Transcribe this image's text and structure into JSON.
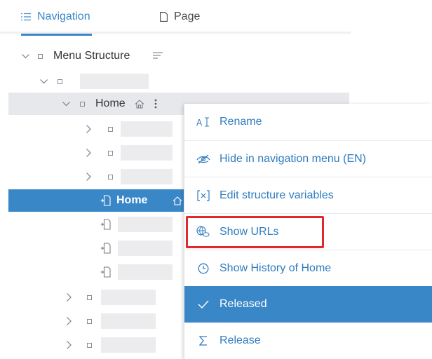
{
  "tabs": [
    {
      "label": "Navigation",
      "icon": "list-icon",
      "active": true
    },
    {
      "label": "Page",
      "icon": "page-icon",
      "active": false
    }
  ],
  "tree": {
    "root_label": "Menu Structure",
    "home_label": "Home",
    "selected_home_label": "Home"
  },
  "context_menu": {
    "items": [
      {
        "label": "Rename",
        "icon": "rename-icon"
      },
      {
        "label": "Hide in navigation menu (EN)",
        "icon": "eye-off-icon"
      },
      {
        "label": "Edit structure variables",
        "icon": "variable-icon"
      },
      {
        "label": "Show URLs",
        "icon": "globe-link-icon"
      },
      {
        "label": "Show History of Home",
        "icon": "clock-icon"
      },
      {
        "label": "Released",
        "icon": "check-icon"
      },
      {
        "label": "Release",
        "icon": "sigma-icon"
      }
    ]
  },
  "colors": {
    "accent": "#3a87c8",
    "highlight": "#e0282e"
  }
}
